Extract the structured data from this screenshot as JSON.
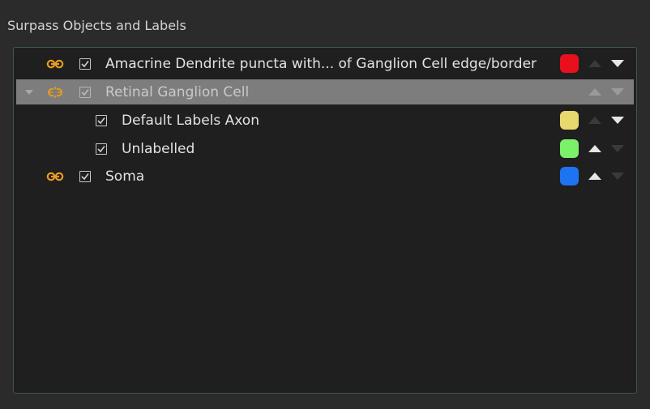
{
  "panel": {
    "title": "Surpass Objects and Labels"
  },
  "tree": {
    "rows": [
      {
        "label": "Amacrine Dendrite puncta with... of Ganglion Cell edge/border",
        "checked": true,
        "color": "#e8101c",
        "icon": "link-icon",
        "move_up_enabled": false,
        "move_down_enabled": true
      },
      {
        "label": "Retinal Ganglion Cell",
        "checked": true,
        "selected": true,
        "expanded": true,
        "icon": "broken-link-icon",
        "move_up_enabled": false,
        "move_down_enabled": false
      },
      {
        "label": "Default Labels Axon",
        "checked": true,
        "color": "#e8d96e",
        "move_up_enabled": false,
        "move_down_enabled": true
      },
      {
        "label": "Unlabelled",
        "checked": true,
        "color": "#7df06a",
        "move_up_enabled": true,
        "move_down_enabled": false
      },
      {
        "label": "Soma",
        "checked": true,
        "color": "#1e74f0",
        "icon": "link-icon",
        "move_up_enabled": true,
        "move_down_enabled": false
      }
    ]
  },
  "colors": {
    "background": "#2b2b2b",
    "tree_background": "#1f1f1f",
    "selection": "#7d7d7d",
    "link_icon": "#e89b1e"
  }
}
